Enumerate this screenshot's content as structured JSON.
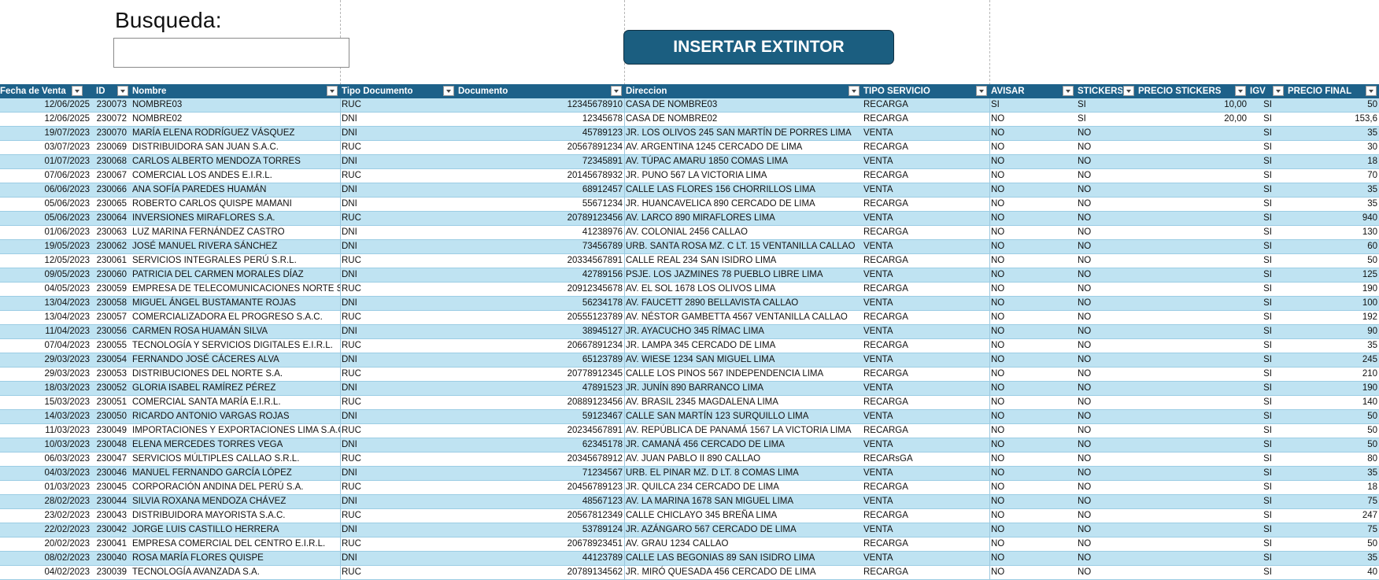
{
  "search": {
    "label": "Busqueda:",
    "value": "",
    "placeholder": ""
  },
  "insert_button": {
    "label": "INSERTAR EXTINTOR"
  },
  "colors": {
    "header_bg": "#1d6189",
    "band": "#bfe3f2",
    "button_bg": "#1b5e80"
  },
  "icons": {
    "filter": "filter-dropdown-icon"
  },
  "table": {
    "columns": [
      "Fecha de Venta",
      "ID",
      "Nombre",
      "Tipo Documento",
      "Documento",
      "Direccion",
      "TIPO SERVICIO",
      "AVISAR",
      "STICKERS",
      "PRECIO STICKERS",
      "IGV",
      "PRECIO FINAL"
    ],
    "rows": [
      [
        "12/06/2025",
        "230073",
        "NOMBRE03",
        "RUC",
        "12345678910",
        "CASA DE NOMBRE03",
        "RECARGA",
        "SI",
        "SI",
        "10,00",
        "SI",
        "50"
      ],
      [
        "12/06/2025",
        "230072",
        "NOMBRE02",
        "DNI",
        "12345678",
        "CASA DE NOMBRE02",
        "RECARGA",
        "NO",
        "SI",
        "20,00",
        "SI",
        "153,6"
      ],
      [
        "19/07/2023",
        "230070",
        "MARÍA ELENA RODRÍGUEZ VÁSQUEZ",
        "DNI",
        "45789123",
        "JR. LOS OLIVOS 245 SAN MARTÍN DE PORRES LIMA",
        "VENTA",
        "NO",
        "NO",
        "",
        "SI",
        "35"
      ],
      [
        "03/07/2023",
        "230069",
        "DISTRIBUIDORA SAN JUAN S.A.C.",
        "RUC",
        "20567891234",
        "AV. ARGENTINA 1245 CERCADO DE LIMA",
        "RECARGA",
        "NO",
        "NO",
        "",
        "SI",
        "30"
      ],
      [
        "01/07/2023",
        "230068",
        "CARLOS ALBERTO MENDOZA TORRES",
        "DNI",
        "72345891",
        "AV. TÚPAC AMARU 1850 COMAS LIMA",
        "VENTA",
        "NO",
        "NO",
        "",
        "SI",
        "18"
      ],
      [
        "07/06/2023",
        "230067",
        "COMERCIAL LOS ANDES E.I.R.L.",
        "RUC",
        "20145678932",
        "JR. PUNO 567 LA VICTORIA LIMA",
        "RECARGA",
        "NO",
        "NO",
        "",
        "SI",
        "70"
      ],
      [
        "06/06/2023",
        "230066",
        "ANA SOFÍA PAREDES HUAMÁN",
        "DNI",
        "68912457",
        "CALLE LAS FLORES 156 CHORRILLOS LIMA",
        "VENTA",
        "NO",
        "NO",
        "",
        "SI",
        "35"
      ],
      [
        "05/06/2023",
        "230065",
        "ROBERTO CARLOS QUISPE MAMANI",
        "DNI",
        "55671234",
        "JR. HUANCAVELICA 890 CERCADO DE LIMA",
        "RECARGA",
        "NO",
        "NO",
        "",
        "SI",
        "35"
      ],
      [
        "05/06/2023",
        "230064",
        "INVERSIONES MIRAFLORES S.A.",
        "RUC",
        "20789123456",
        "AV. LARCO 890 MIRAFLORES LIMA",
        "VENTA",
        "NO",
        "NO",
        "",
        "SI",
        "940"
      ],
      [
        "01/06/2023",
        "230063",
        "LUZ MARINA FERNÁNDEZ CASTRO",
        "DNI",
        "41238976",
        "AV. COLONIAL 2456 CALLAO",
        "RECARGA",
        "NO",
        "NO",
        "",
        "SI",
        "130"
      ],
      [
        "19/05/2023",
        "230062",
        "JOSÉ MANUEL RIVERA SÁNCHEZ",
        "DNI",
        "73456789",
        "URB. SANTA ROSA MZ. C LT. 15 VENTANILLA CALLAO",
        "VENTA",
        "NO",
        "NO",
        "",
        "SI",
        "60"
      ],
      [
        "12/05/2023",
        "230061",
        "SERVICIOS INTEGRALES PERÚ S.R.L.",
        "RUC",
        "20334567891",
        "CALLE REAL 234 SAN ISIDRO LIMA",
        "RECARGA",
        "NO",
        "NO",
        "",
        "SI",
        "50"
      ],
      [
        "09/05/2023",
        "230060",
        "PATRICIA DEL CARMEN MORALES DÍAZ",
        "DNI",
        "42789156",
        "PSJE. LOS JAZMINES 78 PUEBLO LIBRE LIMA",
        "VENTA",
        "NO",
        "NO",
        "",
        "SI",
        "125"
      ],
      [
        "04/05/2023",
        "230059",
        "EMPRESA DE TELECOMUNICACIONES NORTE S.A.C.",
        "RUC",
        "20912345678",
        "AV. EL SOL 1678 LOS OLIVOS LIMA",
        "RECARGA",
        "NO",
        "NO",
        "",
        "SI",
        "190"
      ],
      [
        "13/04/2023",
        "230058",
        "MIGUEL ÁNGEL BUSTAMANTE ROJAS",
        "DNI",
        "56234178",
        "AV. FAUCETT 2890 BELLAVISTA CALLAO",
        "VENTA",
        "NO",
        "NO",
        "",
        "SI",
        "100"
      ],
      [
        "13/04/2023",
        "230057",
        "COMERCIALIZADORA EL PROGRESO S.A.C.",
        "RUC",
        "20555123789",
        "AV. NÉSTOR GAMBETTA 4567 VENTANILLA CALLAO",
        "RECARGA",
        "NO",
        "NO",
        "",
        "SI",
        "192"
      ],
      [
        "11/04/2023",
        "230056",
        "CARMEN ROSA HUAMÁN SILVA",
        "DNI",
        "38945127",
        "JR. AYACUCHO 345 RÍMAC LIMA",
        "VENTA",
        "NO",
        "NO",
        "",
        "SI",
        "90"
      ],
      [
        "07/04/2023",
        "230055",
        "TECNOLOGÍA Y SERVICIOS DIGITALES E.I.R.L.",
        "RUC",
        "20667891234",
        "JR. LAMPA 345 CERCADO DE LIMA",
        "RECARGA",
        "NO",
        "NO",
        "",
        "SI",
        "35"
      ],
      [
        "29/03/2023",
        "230054",
        "FERNANDO JOSÉ CÁCERES ALVA",
        "DNI",
        "65123789",
        "AV. WIESE 1234 SAN MIGUEL LIMA",
        "VENTA",
        "NO",
        "NO",
        "",
        "SI",
        "245"
      ],
      [
        "29/03/2023",
        "230053",
        "DISTRIBUCIONES DEL NORTE S.A.",
        "RUC",
        "20778912345",
        "CALLE LOS PINOS 567 INDEPENDENCIA LIMA",
        "RECARGA",
        "NO",
        "NO",
        "",
        "SI",
        "210"
      ],
      [
        "18/03/2023",
        "230052",
        "GLORIA ISABEL RAMÍREZ PÉREZ",
        "DNI",
        "47891523",
        "JR. JUNÍN 890 BARRANCO LIMA",
        "VENTA",
        "NO",
        "NO",
        "",
        "SI",
        "190"
      ],
      [
        "15/03/2023",
        "230051",
        "COMERCIAL SANTA MARÍA E.I.R.L.",
        "RUC",
        "20889123456",
        "AV. BRASIL 2345 MAGDALENA LIMA",
        "RECARGA",
        "NO",
        "NO",
        "",
        "SI",
        "140"
      ],
      [
        "14/03/2023",
        "230050",
        "RICARDO ANTONIO VARGAS ROJAS",
        "DNI",
        "59123467",
        "CALLE SAN MARTÍN 123 SURQUILLO LIMA",
        "VENTA",
        "NO",
        "NO",
        "",
        "SI",
        "50"
      ],
      [
        "11/03/2023",
        "230049",
        "IMPORTACIONES Y EXPORTACIONES LIMA S.A.C.",
        "RUC",
        "20234567891",
        "AV. REPÚBLICA DE PANAMÁ 1567 LA VICTORIA LIMA",
        "RECARGA",
        "NO",
        "NO",
        "",
        "SI",
        "50"
      ],
      [
        "10/03/2023",
        "230048",
        "ELENA MERCEDES TORRES VEGA",
        "DNI",
        "62345178",
        "JR. CAMANÁ 456 CERCADO DE LIMA",
        "VENTA",
        "NO",
        "NO",
        "",
        "SI",
        "50"
      ],
      [
        "06/03/2023",
        "230047",
        "SERVICIOS MÚLTIPLES CALLAO S.R.L.",
        "RUC",
        "20345678912",
        "AV. JUAN PABLO II 890 CALLAO",
        "RECARsGA",
        "NO",
        "NO",
        "",
        "SI",
        "80"
      ],
      [
        "04/03/2023",
        "230046",
        "MANUEL FERNANDO GARCÍA LÓPEZ",
        "DNI",
        "71234567",
        "URB. EL PINAR MZ. D LT. 8 COMAS LIMA",
        "VENTA",
        "NO",
        "NO",
        "",
        "SI",
        "35"
      ],
      [
        "01/03/2023",
        "230045",
        "CORPORACIÓN ANDINA DEL PERÚ S.A.",
        "RUC",
        "20456789123",
        "JR. QUILCA 234 CERCADO DE LIMA",
        "RECARGA",
        "NO",
        "NO",
        "",
        "SI",
        "18"
      ],
      [
        "28/02/2023",
        "230044",
        "SILVIA ROXANA MENDOZA CHÁVEZ",
        "DNI",
        "48567123",
        "AV. LA MARINA 1678 SAN MIGUEL LIMA",
        "VENTA",
        "NO",
        "NO",
        "",
        "SI",
        "75"
      ],
      [
        "23/02/2023",
        "230043",
        "DISTRIBUIDORA MAYORISTA S.A.C.",
        "RUC",
        "20567812349",
        "CALLE CHICLAYO 345 BREÑA LIMA",
        "RECARGA",
        "NO",
        "NO",
        "",
        "SI",
        "247"
      ],
      [
        "22/02/2023",
        "230042",
        "JORGE LUIS CASTILLO HERRERA",
        "DNI",
        "53789124",
        "JR. AZÁNGARO 567 CERCADO DE LIMA",
        "VENTA",
        "NO",
        "NO",
        "",
        "SI",
        "75"
      ],
      [
        "20/02/2023",
        "230041",
        "EMPRESA COMERCIAL DEL CENTRO E.I.R.L.",
        "RUC",
        "20678923451",
        "AV. GRAU 1234 CALLAO",
        "RECARGA",
        "NO",
        "NO",
        "",
        "SI",
        "50"
      ],
      [
        "08/02/2023",
        "230040",
        "ROSA MARÍA FLORES QUISPE",
        "DNI",
        "44123789",
        "CALLE LAS BEGONIAS 89 SAN ISIDRO LIMA",
        "VENTA",
        "NO",
        "NO",
        "",
        "SI",
        "35"
      ],
      [
        "04/02/2023",
        "230039",
        "TECNOLOGÍA AVANZADA S.A.",
        "RUC",
        "20789134562",
        "JR. MIRÓ QUESADA 456 CERCADO DE LIMA",
        "RECARGA",
        "NO",
        "NO",
        "",
        "SI",
        "40"
      ]
    ]
  }
}
